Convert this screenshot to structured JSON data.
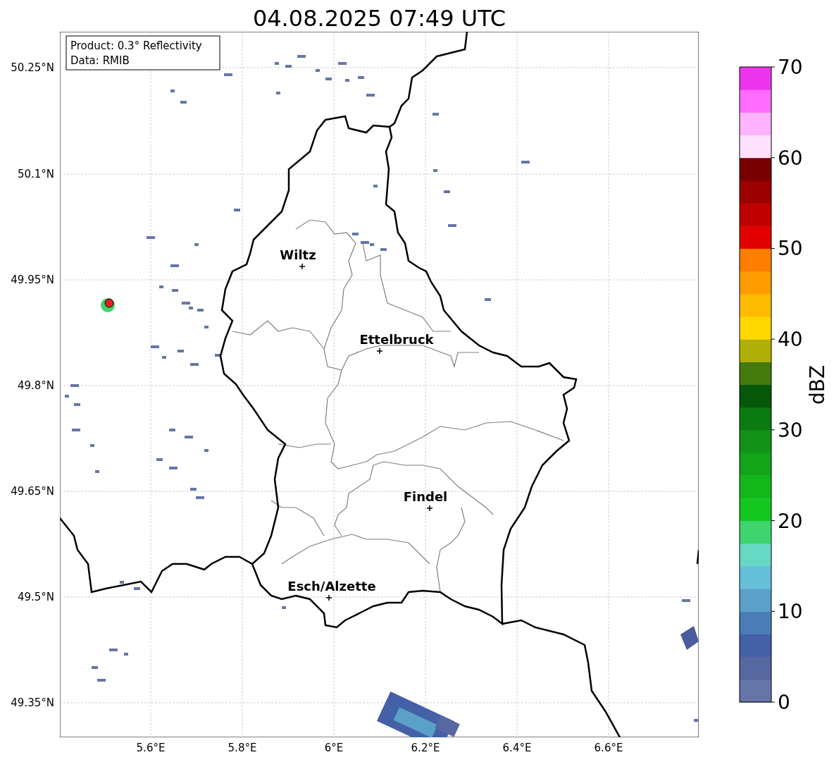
{
  "title": "04.08.2025 07:49 UTC",
  "info_box": [
    "Product: 0.3° Reflectivity",
    "Data: RMIB"
  ],
  "map": {
    "lat_labels": [
      "50.25°N",
      "50.1°N",
      "49.95°N",
      "49.8°N",
      "49.65°N",
      "49.5°N",
      "49.35°N"
    ],
    "lon_labels": [
      "5.6°E",
      "5.8°E",
      "6°E",
      "6.2°E",
      "6.4°E",
      "6.6°E"
    ],
    "places": [
      {
        "name": "Wiltz"
      },
      {
        "name": "Ettelbruck"
      },
      {
        "name": "Findel"
      },
      {
        "name": "Esch/Alzette"
      }
    ]
  },
  "colorbar": {
    "label": "dBZ",
    "ticks": [
      "70",
      "60",
      "50",
      "40",
      "30",
      "20",
      "10",
      "0"
    ],
    "bands": [
      {
        "color": "#6675a8"
      },
      {
        "color": "#57679f"
      },
      {
        "color": "#4460a6"
      },
      {
        "color": "#4a7db5"
      },
      {
        "color": "#5aa0c8"
      },
      {
        "color": "#66c0da"
      },
      {
        "color": "#66d8c4"
      },
      {
        "color": "#3fd46e"
      },
      {
        "color": "#14c820"
      },
      {
        "color": "#12b81a"
      },
      {
        "color": "#12a51a"
      },
      {
        "color": "#129317"
      },
      {
        "color": "#0b7a10"
      },
      {
        "color": "#07560a"
      },
      {
        "color": "#457a0c"
      },
      {
        "color": "#b0b008"
      },
      {
        "color": "#ffd800"
      },
      {
        "color": "#ffbb00"
      },
      {
        "color": "#ff9c00"
      },
      {
        "color": "#ff7d00"
      },
      {
        "color": "#e20000"
      },
      {
        "color": "#c00000"
      },
      {
        "color": "#9c0000"
      },
      {
        "color": "#780000"
      },
      {
        "color": "#ffe0ff"
      },
      {
        "color": "#ffb4ff"
      },
      {
        "color": "#ff6cff"
      },
      {
        "color": "#ec34ec"
      }
    ]
  }
}
